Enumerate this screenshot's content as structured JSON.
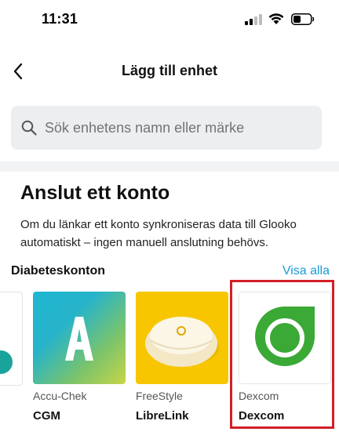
{
  "status_bar": {
    "time": "11:31"
  },
  "nav": {
    "title": "Lägg till enhet",
    "back_icon": "chevron-left-icon"
  },
  "search": {
    "placeholder": "Sök enhetens namn eller märke",
    "value": "",
    "icon": "search-icon"
  },
  "connect_section": {
    "heading": "Anslut ett konto",
    "description": "Om du länkar ett konto synkroniseras data till Glooko automatiskt – ingen manuell anslutning behövs."
  },
  "diabetes_accounts": {
    "title": "Diabeteskonton",
    "see_all": "Visa alla",
    "cards": [
      {
        "brand": "Accu-Chek",
        "name": "CGM",
        "logo_letter": "A"
      },
      {
        "brand": "FreeStyle",
        "name": "LibreLink",
        "logo_icon": "libre-sensor-icon"
      },
      {
        "brand": "Dexcom",
        "name": "Dexcom",
        "logo_icon": "dexcom-logo-icon"
      }
    ]
  },
  "colors": {
    "accent_link": "#1a9bd7",
    "highlight": "#d21f26",
    "dexcom_green": "#3aa935",
    "libre_yellow": "#f7c600"
  }
}
